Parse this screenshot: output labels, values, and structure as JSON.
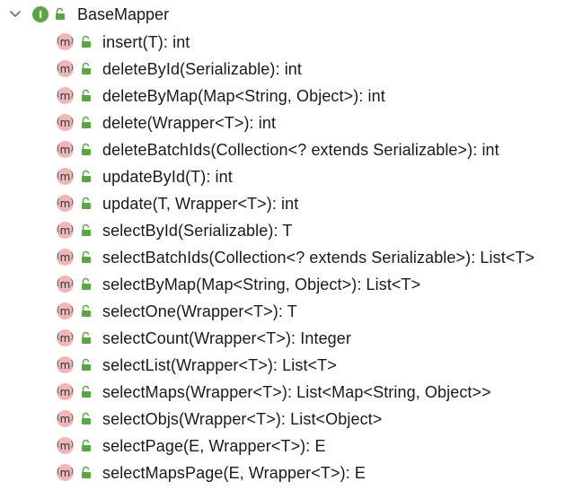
{
  "interface": {
    "icon_letter": "I",
    "name": "BaseMapper"
  },
  "method_icon": {
    "letter": "m"
  },
  "methods": [
    {
      "label": "insert(T): int"
    },
    {
      "label": "deleteById(Serializable): int"
    },
    {
      "label": "deleteByMap(Map<String, Object>): int"
    },
    {
      "label": "delete(Wrapper<T>): int"
    },
    {
      "label": "deleteBatchIds(Collection<? extends Serializable>): int"
    },
    {
      "label": "updateById(T): int"
    },
    {
      "label": "update(T, Wrapper<T>): int"
    },
    {
      "label": "selectById(Serializable): T"
    },
    {
      "label": "selectBatchIds(Collection<? extends Serializable>): List<T>"
    },
    {
      "label": "selectByMap(Map<String, Object>): List<T>"
    },
    {
      "label": "selectOne(Wrapper<T>): T"
    },
    {
      "label": "selectCount(Wrapper<T>): Integer"
    },
    {
      "label": "selectList(Wrapper<T>): List<T>"
    },
    {
      "label": "selectMaps(Wrapper<T>): List<Map<String, Object>>"
    },
    {
      "label": "selectObjs(Wrapper<T>): List<Object>"
    },
    {
      "label": "selectPage(E, Wrapper<T>): E"
    },
    {
      "label": "selectMapsPage(E, Wrapper<T>): E"
    }
  ],
  "colors": {
    "interface_icon": "#58a744",
    "method_icon": "#f3b6b6",
    "lock": "#58a744"
  }
}
